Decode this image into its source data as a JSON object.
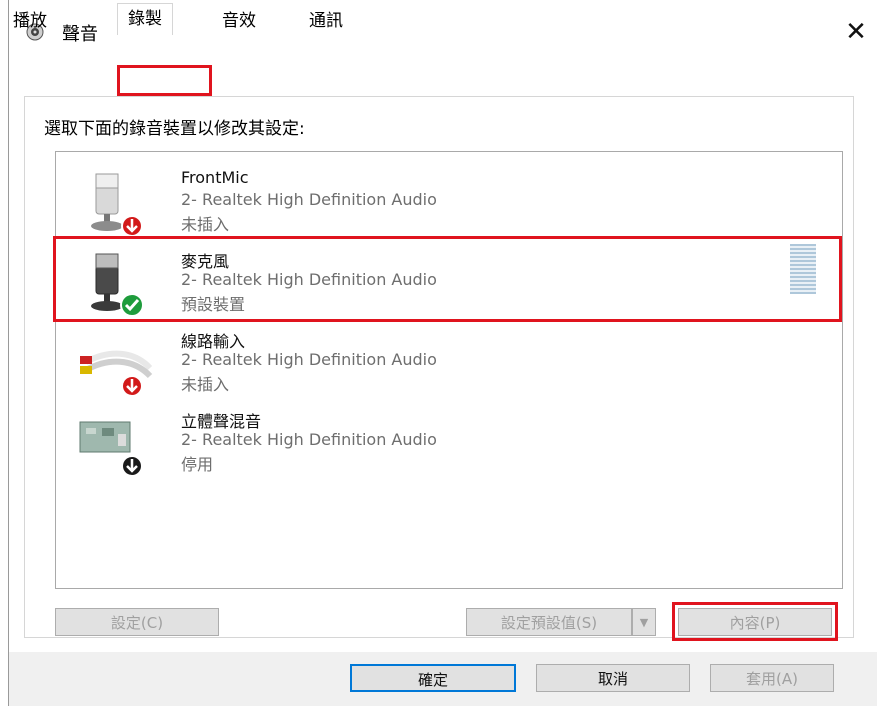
{
  "window": {
    "title": "聲音"
  },
  "tabs": [
    {
      "label": "播放"
    },
    {
      "label": "錄製"
    },
    {
      "label": "音效"
    },
    {
      "label": "通訊"
    }
  ],
  "instruction": "選取下面的錄音裝置以修改其設定:",
  "devices": [
    {
      "name": "FrontMic",
      "driver": "2- Realtek High Definition Audio",
      "status": "未插入",
      "icon": "microphone-icon",
      "badge": "red-down-arrow"
    },
    {
      "name": "麥克風",
      "driver": "2- Realtek High Definition Audio",
      "status": "預設裝置",
      "icon": "microphone-icon",
      "badge": "green-check"
    },
    {
      "name": "線路輸入",
      "driver": "2- Realtek High Definition Audio",
      "status": "未插入",
      "icon": "line-in-cable-icon",
      "badge": "red-down-arrow"
    },
    {
      "name": "立體聲混音",
      "driver": "2- Realtek High Definition Audio",
      "status": "停用",
      "icon": "sound-card-icon",
      "badge": "black-down-arrow"
    }
  ],
  "buttons": {
    "configure": "設定(C)",
    "set_default": "設定預設值(S)",
    "properties": "內容(P)",
    "ok": "確定",
    "cancel": "取消",
    "apply": "套用(A)"
  },
  "colors": {
    "highlight": "#e0141e",
    "focus": "#0078d7",
    "selected_row": "#cce8ff"
  }
}
